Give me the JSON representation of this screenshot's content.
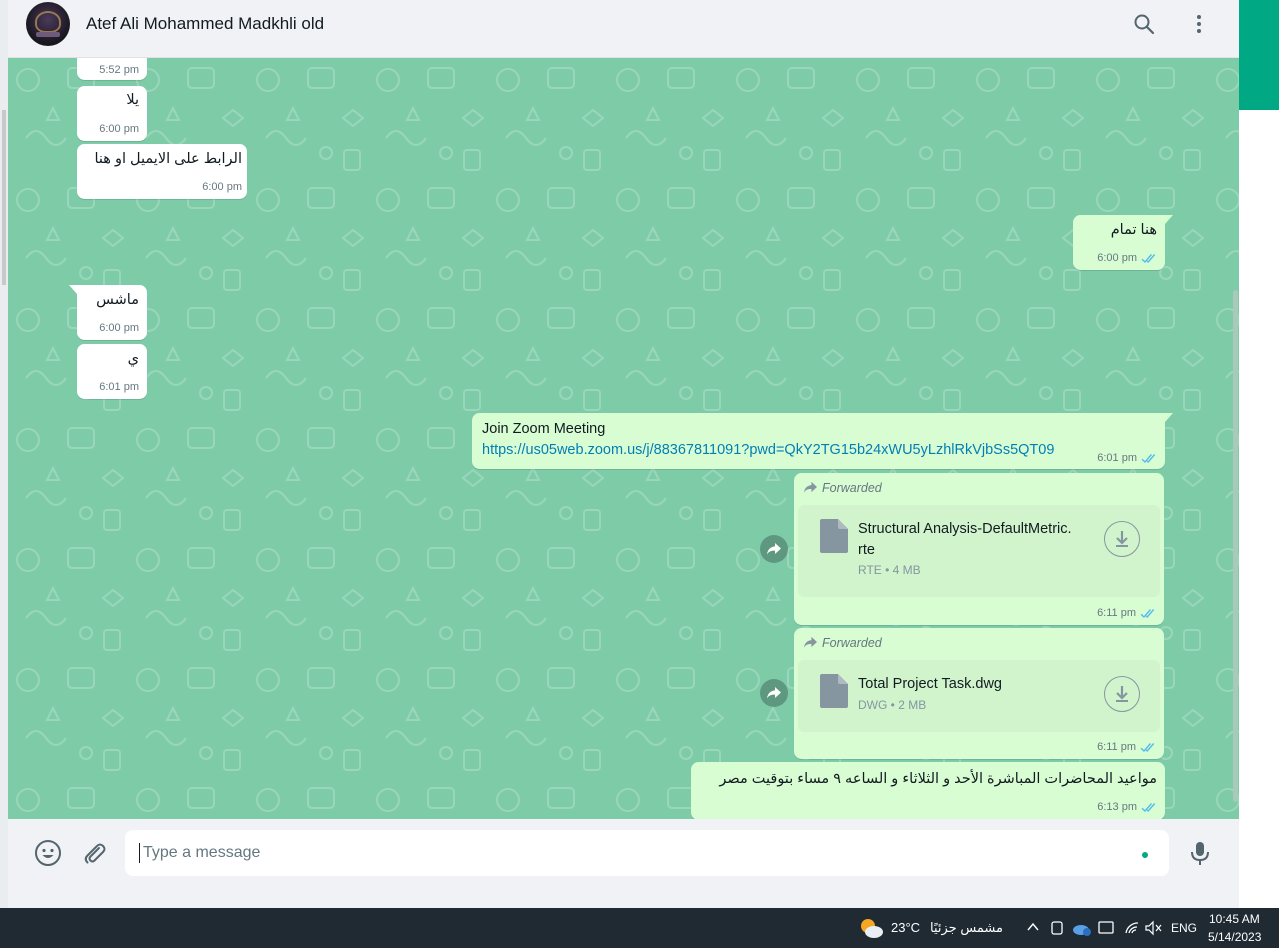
{
  "header": {
    "contact_name": "Atef Ali Mohammed Madkhli old"
  },
  "messages": [
    {
      "direction": "in",
      "time": "5:52 pm"
    },
    {
      "direction": "in",
      "text": "يلا",
      "time": "6:00 pm"
    },
    {
      "direction": "in",
      "text": "الرابط على الايميل او هنا",
      "time": "6:00 pm"
    },
    {
      "direction": "out",
      "text": "هنا تمام",
      "time": "6:00 pm"
    },
    {
      "direction": "in",
      "text": "ماشس",
      "time": "6:00 pm"
    },
    {
      "direction": "in",
      "text": "ي",
      "time": "6:01 pm"
    },
    {
      "direction": "out",
      "text": "Join Zoom Meeting",
      "link": "https://us05web.zoom.us/j/88367811091?pwd=QkY2TG15b24xWU5yLzhlRkVjbSs5QT09",
      "time": "6:01 pm"
    },
    {
      "direction": "out",
      "forwarded_label": "Forwarded",
      "file_name": "Structural Analysis-DefaultMetric.rte",
      "file_name_line1": "Structural Analysis-DefaultMetric.",
      "file_name_line2": "rte",
      "file_type": "RTE",
      "file_size": "4 MB",
      "time": "6:11 pm"
    },
    {
      "direction": "out",
      "forwarded_label": "Forwarded",
      "file_name": "Total Project Task.dwg",
      "file_type": "DWG",
      "file_size": "2 MB",
      "time": "6:11 pm"
    },
    {
      "direction": "out",
      "text": "مواعيد المحاضرات المباشرة الأحد و الثلاثاء و الساعه ٩ مساء بتوقيت مصر",
      "time": "6:13 pm"
    }
  ],
  "composer": {
    "placeholder": "Type a message"
  },
  "taskbar": {
    "temperature": "23°C",
    "weather": "مشمس جزئيًا",
    "language": "ENG",
    "time": "10:45 AM",
    "date": "5/14/2023"
  },
  "colors": {
    "chat_background": "#7ecba8",
    "outgoing_bubble": "#d9fdd3",
    "incoming_bubble": "#ffffff",
    "accent": "#00a884",
    "link": "#027eb5",
    "read_ticks": "#53bdeb"
  },
  "icons": [
    "search-icon",
    "menu-icon",
    "forward-icon",
    "file-icon",
    "download-icon",
    "share-icon",
    "emoji-icon",
    "attach-icon",
    "mic-icon",
    "double-tick-icon",
    "weather-icon"
  ]
}
